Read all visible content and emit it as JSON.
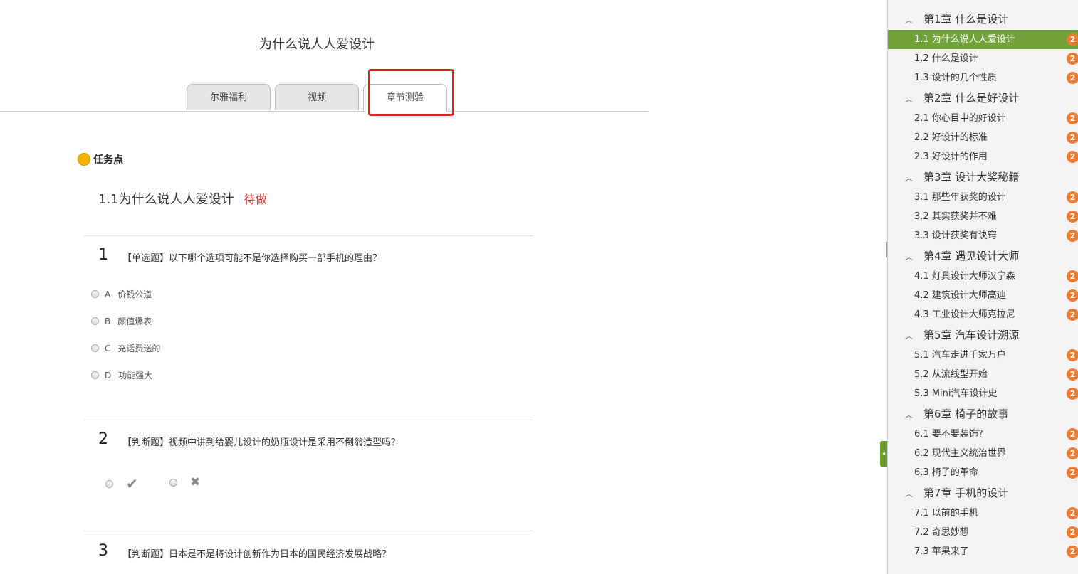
{
  "page": {
    "title": "为什么说人人爱设计"
  },
  "tabs": [
    {
      "label": "尔雅福利"
    },
    {
      "label": "视频"
    },
    {
      "label": "章节测验"
    }
  ],
  "task_point": {
    "label": "任务点"
  },
  "section": {
    "title": "1.1为什么说人人爱设计",
    "status": "待做"
  },
  "questions": [
    {
      "num": "1",
      "text": "【单选题】以下哪个选项可能不是你选择购买一部手机的理由？",
      "options": [
        {
          "letter": "A",
          "text": "价钱公道"
        },
        {
          "letter": "B",
          "text": "颜值爆表"
        },
        {
          "letter": "C",
          "text": "充话费送的"
        },
        {
          "letter": "D",
          "text": "功能强大"
        }
      ]
    },
    {
      "num": "2",
      "text": "【判断题】视频中讲到给婴儿设计的奶瓶设计是采用不倒翁造型吗？",
      "true_mark": "✔",
      "false_mark": "✖"
    },
    {
      "num": "3",
      "text": "【判断题】日本是不是将设计创新作为日本的国民经济发展战略？"
    }
  ],
  "sidebar": {
    "handle_icon": "◂",
    "chapters": [
      {
        "title": "第1章 什么是设计",
        "lessons": [
          {
            "label": "1.1 为什么说人人爱设计",
            "badge": "2"
          },
          {
            "label": "1.2 什么是设计",
            "badge": "2"
          },
          {
            "label": "1.3 设计的几个性质",
            "badge": "2"
          }
        ]
      },
      {
        "title": "第2章 什么是好设计",
        "lessons": [
          {
            "label": "2.1 你心目中的好设计",
            "badge": "2"
          },
          {
            "label": "2.2 好设计的标准",
            "badge": "2"
          },
          {
            "label": "2.3 好设计的作用",
            "badge": "2"
          }
        ]
      },
      {
        "title": "第3章 设计大奖秘籍",
        "lessons": [
          {
            "label": "3.1 那些年获奖的设计",
            "badge": "2"
          },
          {
            "label": "3.2 其实获奖并不难",
            "badge": "2"
          },
          {
            "label": "3.3 设计获奖有诀窍",
            "badge": "2"
          }
        ]
      },
      {
        "title": "第4章 遇见设计大师",
        "lessons": [
          {
            "label": "4.1 灯具设计大师汉宁森",
            "badge": "2"
          },
          {
            "label": "4.2 建筑设计大师高迪",
            "badge": "2"
          },
          {
            "label": "4.3 工业设计大师克拉尼",
            "badge": "2"
          }
        ]
      },
      {
        "title": "第5章 汽车设计溯源",
        "lessons": [
          {
            "label": "5.1 汽车走进千家万户",
            "badge": "2"
          },
          {
            "label": "5.2 从流线型开始",
            "badge": "2"
          },
          {
            "label": "5.3 Mini汽车设计史",
            "badge": "2"
          }
        ]
      },
      {
        "title": "第6章 椅子的故事",
        "lessons": [
          {
            "label": "6.1 要不要装饰？",
            "badge": "2"
          },
          {
            "label": "6.2 现代主义统治世界",
            "badge": "2"
          },
          {
            "label": "6.3 椅子的革命",
            "badge": "2"
          }
        ]
      },
      {
        "title": "第7章 手机的设计",
        "lessons": [
          {
            "label": "7.1 以前的手机",
            "badge": "2"
          },
          {
            "label": "7.2 奇思妙想",
            "badge": "2"
          },
          {
            "label": "7.3 苹果来了",
            "badge": "2"
          }
        ]
      }
    ]
  }
}
